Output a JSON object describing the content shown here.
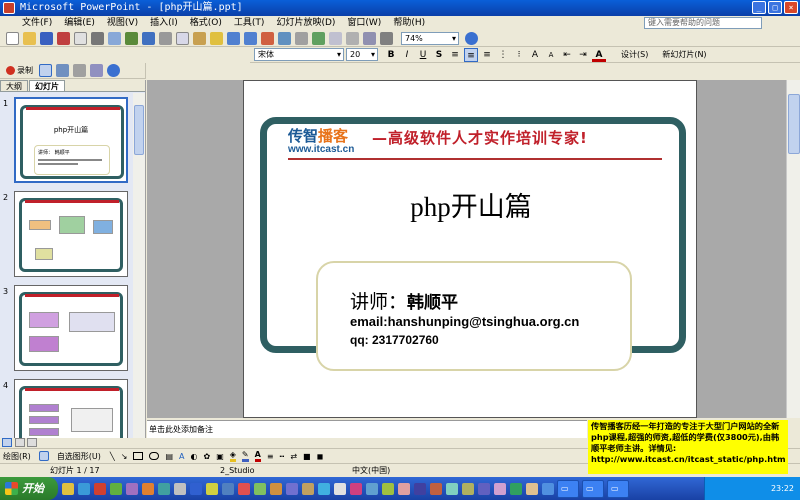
{
  "window": {
    "title": "Microsoft PowerPoint - [php开山篇.ppt]"
  },
  "menu": {
    "items": [
      "文件(F)",
      "编辑(E)",
      "视图(V)",
      "插入(I)",
      "格式(O)",
      "工具(T)",
      "幻灯片放映(D)",
      "窗口(W)",
      "帮助(H)"
    ]
  },
  "help_search": {
    "placeholder": "键入需要帮助的问题"
  },
  "toolbar": {
    "zoom": "74%",
    "font_name": "宋体",
    "font_size": "20",
    "design_label": "设计(S)",
    "new_slide_label": "新幻灯片(N)"
  },
  "toolbar3": {
    "record_label": "录制"
  },
  "left_pane": {
    "tabs": [
      "大纲",
      "幻灯片"
    ],
    "thumb_numbers": [
      "1",
      "2",
      "3",
      "4"
    ],
    "thumb1": {
      "title": "php开山篇",
      "lecturer": "讲师： 韩顺平"
    }
  },
  "slide": {
    "logo_part1": "传智",
    "logo_part2": "播客",
    "logo_url": "www.itcast.cn",
    "slogan": "—高级软件人才实作培训专家!",
    "title": "php开山篇",
    "lecturer_label": "讲师：",
    "lecturer_name": "韩顺平",
    "email": "email:hanshunping@tsinghua.org.cn",
    "qq": "qq: 2317702760"
  },
  "notes": {
    "placeholder": "单击此处添加备注"
  },
  "drawing_toolbar": {
    "draw_label": "绘图(R)",
    "autoshapes_label": "自选图形(U)"
  },
  "status": {
    "slide_pos": "幻灯片 1 / 17",
    "design": "2_Studio",
    "language": "中文(中国)"
  },
  "ad_text": "传智播客历经一年打造的专注于大型门户网站的全新php课程,超强的师资,超低的学费(仅3800元),由韩顺平老师主讲。详情见: http://www.itcast.cn/itcast_static/php.htm",
  "taskbar": {
    "start_label": "开始",
    "clock": "23:22"
  },
  "colors": {
    "frame": "#2f5f62",
    "slogan": "#c0202a",
    "logo_blue": "#1c5a96",
    "ad_bg": "#ffff00"
  }
}
